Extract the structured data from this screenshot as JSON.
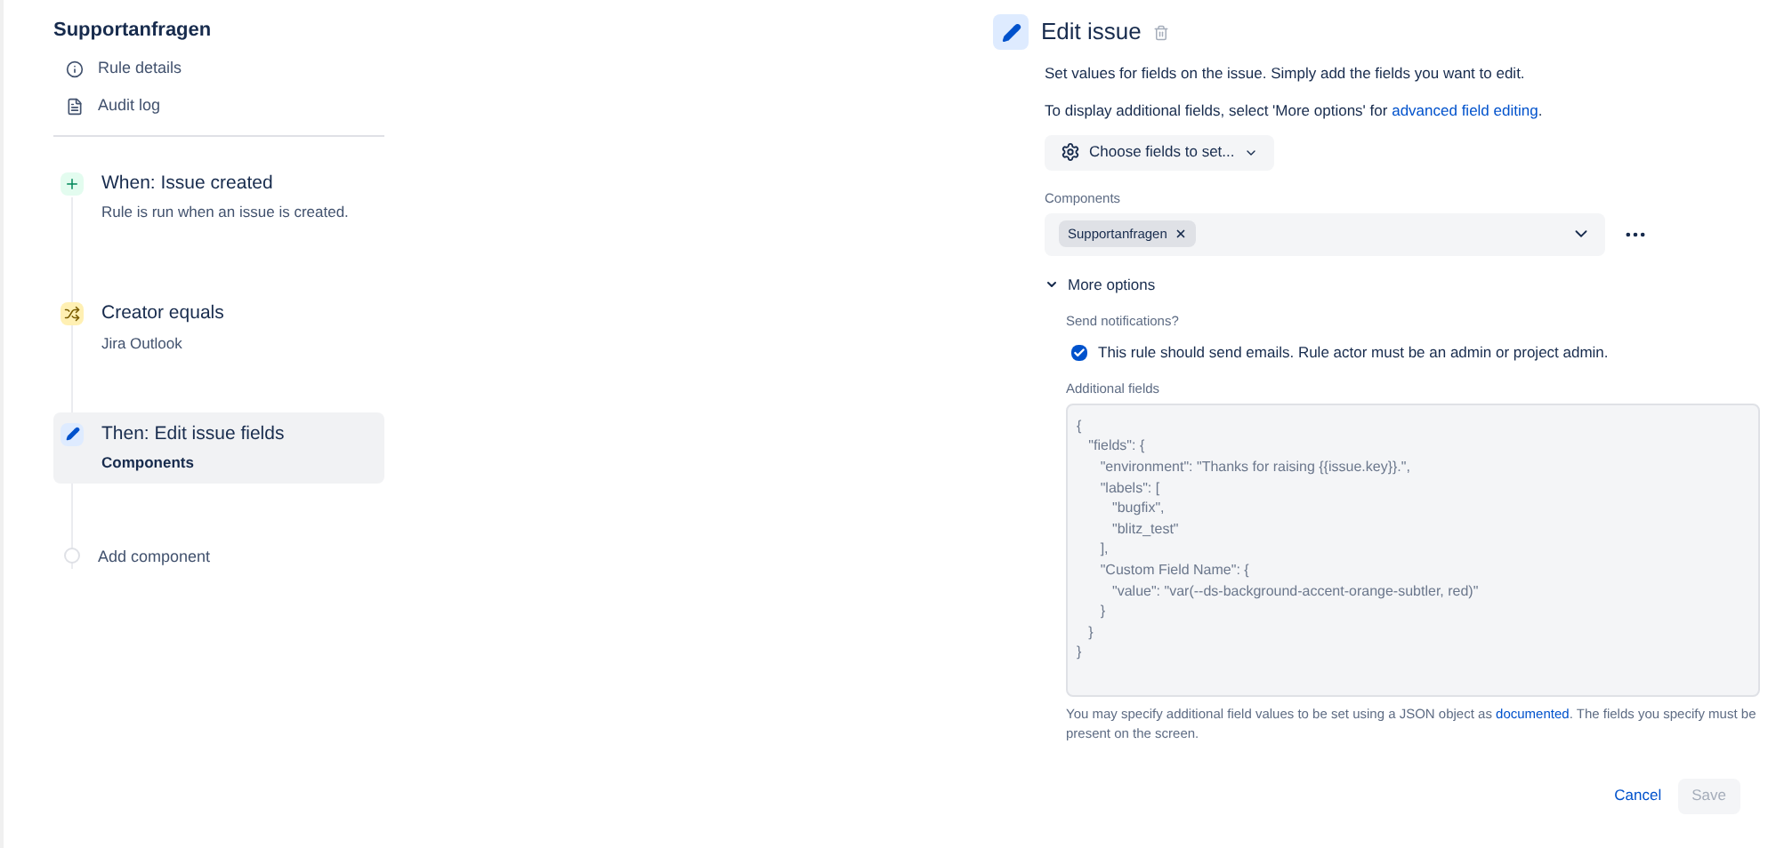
{
  "rule": {
    "title": "Supportanfragen",
    "nav": [
      {
        "kind": "info",
        "label": "Rule details"
      },
      {
        "kind": "log",
        "label": "Audit log"
      }
    ]
  },
  "steps": [
    {
      "kind": "trigger",
      "title": "When: Issue created",
      "subtitle": "Rule is run when an issue is created.",
      "selected": false
    },
    {
      "kind": "condition",
      "title": "Creator equals",
      "subtitle": "Jira Outlook",
      "selected": false
    },
    {
      "kind": "action",
      "title": "Then: Edit issue fields",
      "subtitle": "Components",
      "selected": true
    },
    {
      "kind": "add",
      "title": "Add component",
      "selected": false
    }
  ],
  "editor": {
    "title": "Edit issue",
    "description": "Set values for fields on the issue. Simply add the fields you want to edit.",
    "hint": "To display additional fields, select 'More options' for",
    "hint_link": "advanced field editing",
    "hint_end": ".",
    "choose_button": "Choose fields to set...",
    "components": {
      "label": "Components",
      "tags": [
        "Supportanfragen"
      ]
    },
    "more_options": {
      "label": "More options",
      "expanded": true,
      "notify_label": "Send notifications?",
      "notify_text": "This rule should send emails. Rule actor must be an admin or project admin.",
      "notify_checked": true,
      "additional_label": "Additional fields",
      "code": [
        "{",
        "   \"fields\": {",
        "      \"environment\": \"Thanks for raising {{issue.key}}.\",",
        "      \"labels\": [",
        "         \"bugfix\",",
        "         \"blitz_test\"",
        "      ],",
        "      \"Custom Field Name\": {",
        "         \"value\": \"var(--ds-background-accent-orange-subtler, red)\"",
        "      }",
        "   }",
        "}"
      ],
      "help": "You may specify additional field values to be set using a JSON object as",
      "help_link": "documented",
      "help_end": ". The fields you specify must be present on the screen."
    }
  },
  "buttons": {
    "cancel": "Cancel",
    "save": "Save",
    "save_disabled": true
  }
}
